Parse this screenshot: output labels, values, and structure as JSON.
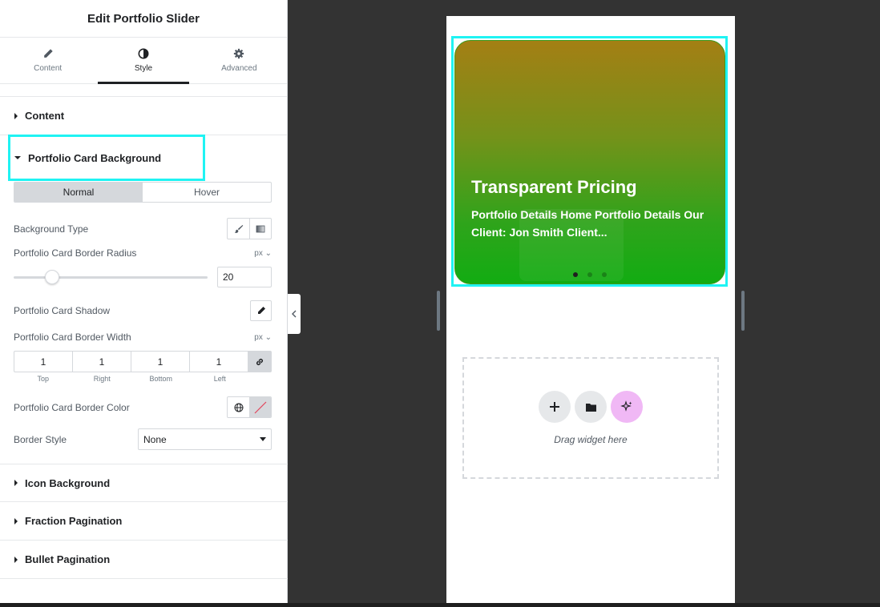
{
  "panel": {
    "title": "Edit Portfolio Slider",
    "tabs": [
      {
        "label": "Content",
        "icon": "pencil-icon"
      },
      {
        "label": "Style",
        "icon": "contrast-icon"
      },
      {
        "label": "Advanced",
        "icon": "gear-icon"
      }
    ],
    "active_tab": "Style"
  },
  "sections": {
    "content": "Content",
    "card_background": "Portfolio Card Background",
    "icon_background": "Icon Background",
    "fraction_pagination": "Fraction Pagination",
    "bullet_pagination": "Bullet Pagination"
  },
  "controls": {
    "state_tabs": [
      "Normal",
      "Hover"
    ],
    "active_state": "Normal",
    "background_type_label": "Background Type",
    "border_radius_label": "Portfolio Card Border Radius",
    "border_radius_unit": "px",
    "border_radius_value": "20",
    "shadow_label": "Portfolio Card Shadow",
    "border_width_label": "Portfolio Card Border Width",
    "border_width_unit": "px",
    "border_width": {
      "top": "1",
      "right": "1",
      "bottom": "1",
      "left": "1"
    },
    "dim_labels": {
      "top": "Top",
      "right": "Right",
      "bottom": "Bottom",
      "left": "Left"
    },
    "border_color_label": "Portfolio Card Border Color",
    "border_style_label": "Border Style",
    "border_style_value": "None"
  },
  "preview": {
    "card_title": "Transparent Pricing",
    "card_description": "Portfolio Details Home Portfolio Details Our Client: Jon Smith Client...",
    "slides": 3,
    "active_slide": 1,
    "drop_text": "Drag widget here"
  },
  "colors": {
    "highlight": "#1ff3f3",
    "ai_button": "#f0b8f5"
  }
}
